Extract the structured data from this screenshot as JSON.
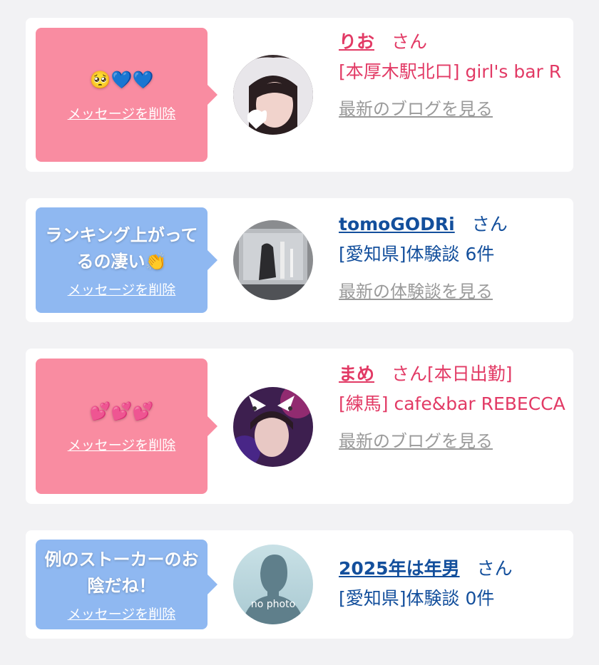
{
  "colors": {
    "pink_bubble": "#f98ca1",
    "blue_bubble": "#8fb8f1",
    "pink_text": "#e23a65",
    "blue_text": "#134f9c",
    "link_gray": "#9a9a9a"
  },
  "cards": [
    {
      "message": "🥺💙💙",
      "delete_label": "メッセージを削除",
      "name": "りお",
      "honorific": "さん",
      "tag": "",
      "shop": "[本厚木駅北口] girl's bar R",
      "latest_link": "最新のブログを見る"
    },
    {
      "message": "ランキング上がってるの凄い👏",
      "delete_label": "メッセージを削除",
      "name": "tomoGODRi",
      "honorific": "さん",
      "tag": "",
      "shop": "[愛知県]体験談 6件",
      "latest_link": "最新の体験談を見る"
    },
    {
      "message": "💕💕💕",
      "delete_label": "メッセージを削除",
      "name": "まめ",
      "honorific": "さん",
      "tag": "[本日出勤]",
      "shop": "[練馬] cafe&bar REBECCA",
      "latest_link": "最新のブログを見る"
    },
    {
      "message": "例のストーカーのお陰だね！",
      "delete_label": "メッセージを削除",
      "name": "2025年は年男",
      "honorific": "さん",
      "tag": "",
      "shop": "[愛知県]体験談 0件",
      "latest_link": "",
      "no_photo_label": "no photo"
    }
  ]
}
